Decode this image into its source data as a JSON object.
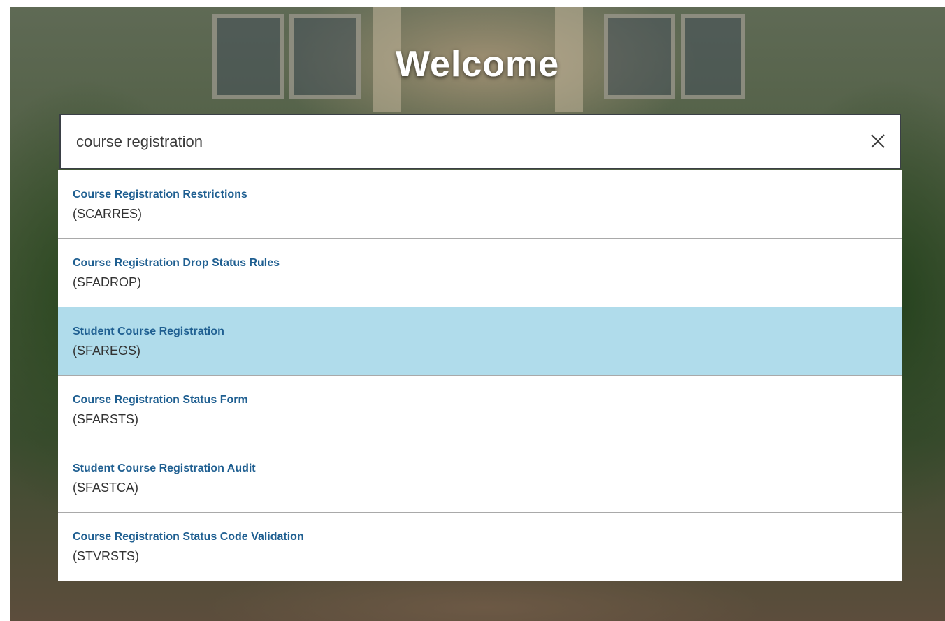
{
  "page": {
    "heading": "Welcome"
  },
  "search": {
    "value": "course registration",
    "placeholder": "",
    "clear_icon": "close-icon"
  },
  "results": [
    {
      "title": "Course Registration Restrictions",
      "code": "(SCARRES)",
      "selected": false
    },
    {
      "title": "Course Registration Drop Status Rules",
      "code": "(SFADROP)",
      "selected": false
    },
    {
      "title": "Student Course Registration",
      "code": "(SFAREGS)",
      "selected": true
    },
    {
      "title": "Course Registration Status Form",
      "code": "(SFARSTS)",
      "selected": false
    },
    {
      "title": "Student Course Registration Audit",
      "code": "(SFASTCA)",
      "selected": false
    },
    {
      "title": "Course Registration Status Code Validation",
      "code": "(STVRSTS)",
      "selected": false
    }
  ],
  "colors": {
    "link": "#1f5f91",
    "selected_row": "#b0dceb",
    "code_text": "#333333"
  }
}
